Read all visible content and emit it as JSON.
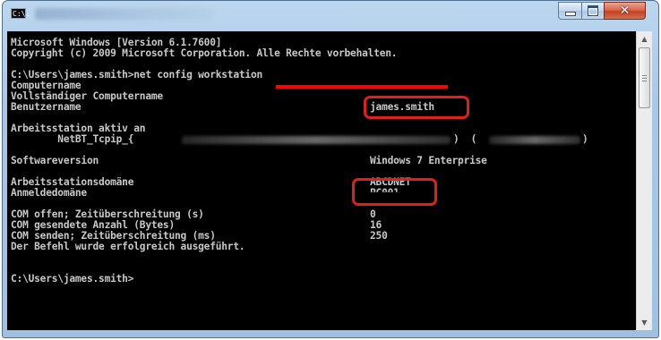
{
  "window": {
    "icon_text": "C:\\.",
    "controls": [
      "minimize",
      "maximize",
      "close"
    ],
    "close_glyph": "✕"
  },
  "console": {
    "lines": [
      "Microsoft Windows [Version 6.1.7600]",
      "Copyright (c) 2009 Microsoft Corporation. Alle Rechte vorbehalten.",
      "C:\\Users\\james.smith>net config workstation",
      "Computername",
      "Vollständiger Computername",
      "Benutzername",
      "Arbeitsstation aktiv an",
      "        NetBT_Tcpip_{",
      "Softwareversion",
      "Arbeitsstationsdomäne",
      "Anmeldedomäne",
      "COM offen; Zeitüberschreitung (s)",
      "COM gesendete Anzahl (Bytes)",
      "COM senden; Zeitüberschreitung (ms)",
      "Der Befehl wurde erfolgreich ausgeführt.",
      "C:\\Users\\james.smith>"
    ],
    "values": {
      "benutzername": "james.smith",
      "netbt_suffix": ")  (",
      "netbt_close": ")",
      "softwareversion": "Windows 7 Enterprise",
      "arbeitsstationsdomaene": "ABCDNET",
      "anmeldedomaene": "PC001",
      "com_offen": "0",
      "com_anzahl": "16",
      "com_senden": "250"
    }
  },
  "colors": {
    "console_bg": "#000000",
    "console_text": "#c8c8c8",
    "highlight": "#e0201a",
    "redaction": "#ff0000"
  }
}
